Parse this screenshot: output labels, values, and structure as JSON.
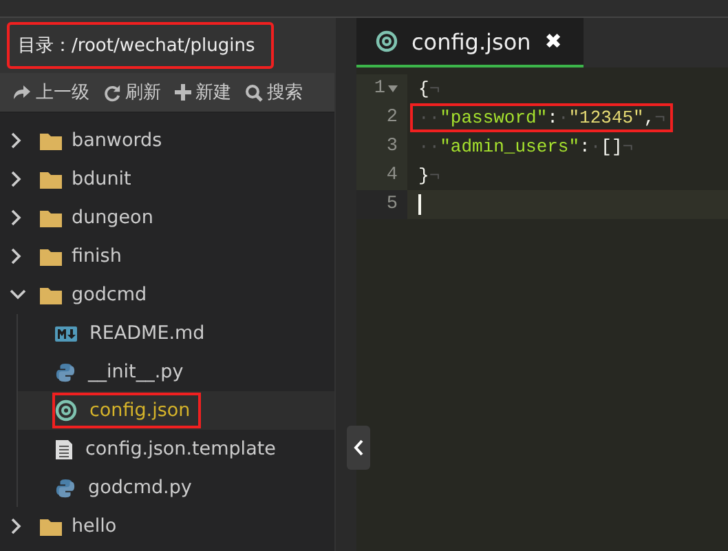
{
  "directory": {
    "label": "目录：",
    "path": "/root/wechat/plugins",
    "highlighted": true
  },
  "toolbar": [
    {
      "kind": "up",
      "label": "上一级"
    },
    {
      "kind": "refresh",
      "label": "刷新"
    },
    {
      "kind": "new",
      "label": "新建"
    },
    {
      "kind": "search",
      "label": "搜索"
    }
  ],
  "tree": [
    {
      "kind": "folder",
      "name": "banwords",
      "expanded": false,
      "selected": false,
      "highlighted": false
    },
    {
      "kind": "folder",
      "name": "bdunit",
      "expanded": false,
      "selected": false,
      "highlighted": false
    },
    {
      "kind": "folder",
      "name": "dungeon",
      "expanded": false,
      "selected": false,
      "highlighted": false
    },
    {
      "kind": "folder",
      "name": "finish",
      "expanded": false,
      "selected": false,
      "highlighted": false
    },
    {
      "kind": "folder",
      "name": "godcmd",
      "expanded": true,
      "selected": false,
      "highlighted": false,
      "children": [
        {
          "kind": "markdown",
          "name": "README.md",
          "selected": false,
          "highlighted": false
        },
        {
          "kind": "python",
          "name": "__init__.py",
          "selected": false,
          "highlighted": false
        },
        {
          "kind": "json",
          "name": "config.json",
          "selected": true,
          "highlighted": true
        },
        {
          "kind": "text",
          "name": "config.json.template",
          "selected": false,
          "highlighted": false
        },
        {
          "kind": "python",
          "name": "godcmd.py",
          "selected": false,
          "highlighted": false
        }
      ]
    },
    {
      "kind": "folder",
      "name": "hello",
      "expanded": false,
      "selected": false,
      "highlighted": false
    }
  ],
  "tabs": [
    {
      "name": "config.json",
      "close": "✖",
      "selected": true
    }
  ],
  "code": [
    {
      "number": "1",
      "fold": true,
      "current": false,
      "highlighted": false,
      "tokens": [
        {
          "kind": "punct",
          "text": "{"
        },
        {
          "kind": "invisible",
          "text": "¬"
        }
      ]
    },
    {
      "number": "2",
      "fold": false,
      "current": false,
      "highlighted": true,
      "tokens": [
        {
          "kind": "invisible",
          "text": "··"
        },
        {
          "kind": "key",
          "text": "\"password\""
        },
        {
          "kind": "punct",
          "text": ":"
        },
        {
          "kind": "invisible",
          "text": "·"
        },
        {
          "kind": "string",
          "text": "\"12345\""
        },
        {
          "kind": "punct",
          "text": ","
        },
        {
          "kind": "invisible",
          "text": "¬"
        }
      ]
    },
    {
      "number": "3",
      "fold": false,
      "current": false,
      "highlighted": false,
      "tokens": [
        {
          "kind": "invisible",
          "text": "··"
        },
        {
          "kind": "key",
          "text": "\"admin_users\""
        },
        {
          "kind": "punct",
          "text": ":"
        },
        {
          "kind": "invisible",
          "text": "·"
        },
        {
          "kind": "punct",
          "text": "[]"
        },
        {
          "kind": "invisible",
          "text": "¬"
        }
      ]
    },
    {
      "number": "4",
      "fold": false,
      "current": false,
      "highlighted": false,
      "tokens": [
        {
          "kind": "punct",
          "text": "}"
        },
        {
          "kind": "invisible",
          "text": "¬"
        }
      ]
    },
    {
      "number": "5",
      "fold": false,
      "current": true,
      "highlighted": false
    }
  ]
}
